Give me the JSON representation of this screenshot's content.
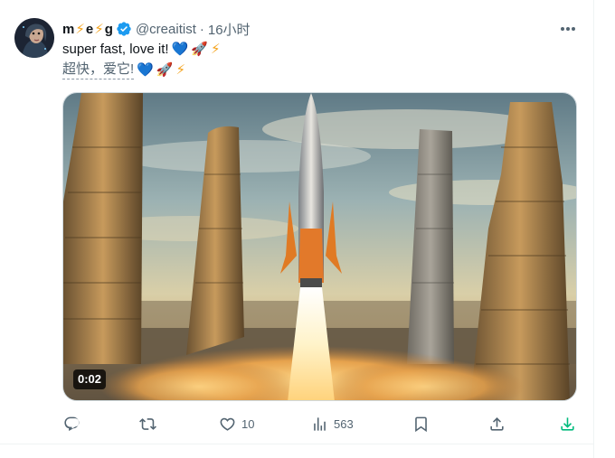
{
  "author": {
    "name_parts": [
      "m",
      "e",
      "g"
    ],
    "handle": "@creaitist",
    "separator": "·",
    "time": "16小时"
  },
  "tweet": {
    "text_en": "super fast, love it!",
    "text_cn": "超快，爱它!",
    "emojis": [
      "💙",
      "🚀",
      "⚡"
    ]
  },
  "media": {
    "duration": "0:02"
  },
  "actions": {
    "reply_count": "",
    "retweet_count": "",
    "like_count": "10",
    "view_count": "563"
  },
  "colors": {
    "accent": "#1d9bf0",
    "download": "#00ba7c",
    "muted": "#536471"
  },
  "icons": [
    "more-icon",
    "verified-icon",
    "reply-icon",
    "retweet-icon",
    "like-icon",
    "views-icon",
    "bookmark-icon",
    "share-icon",
    "download-icon"
  ]
}
